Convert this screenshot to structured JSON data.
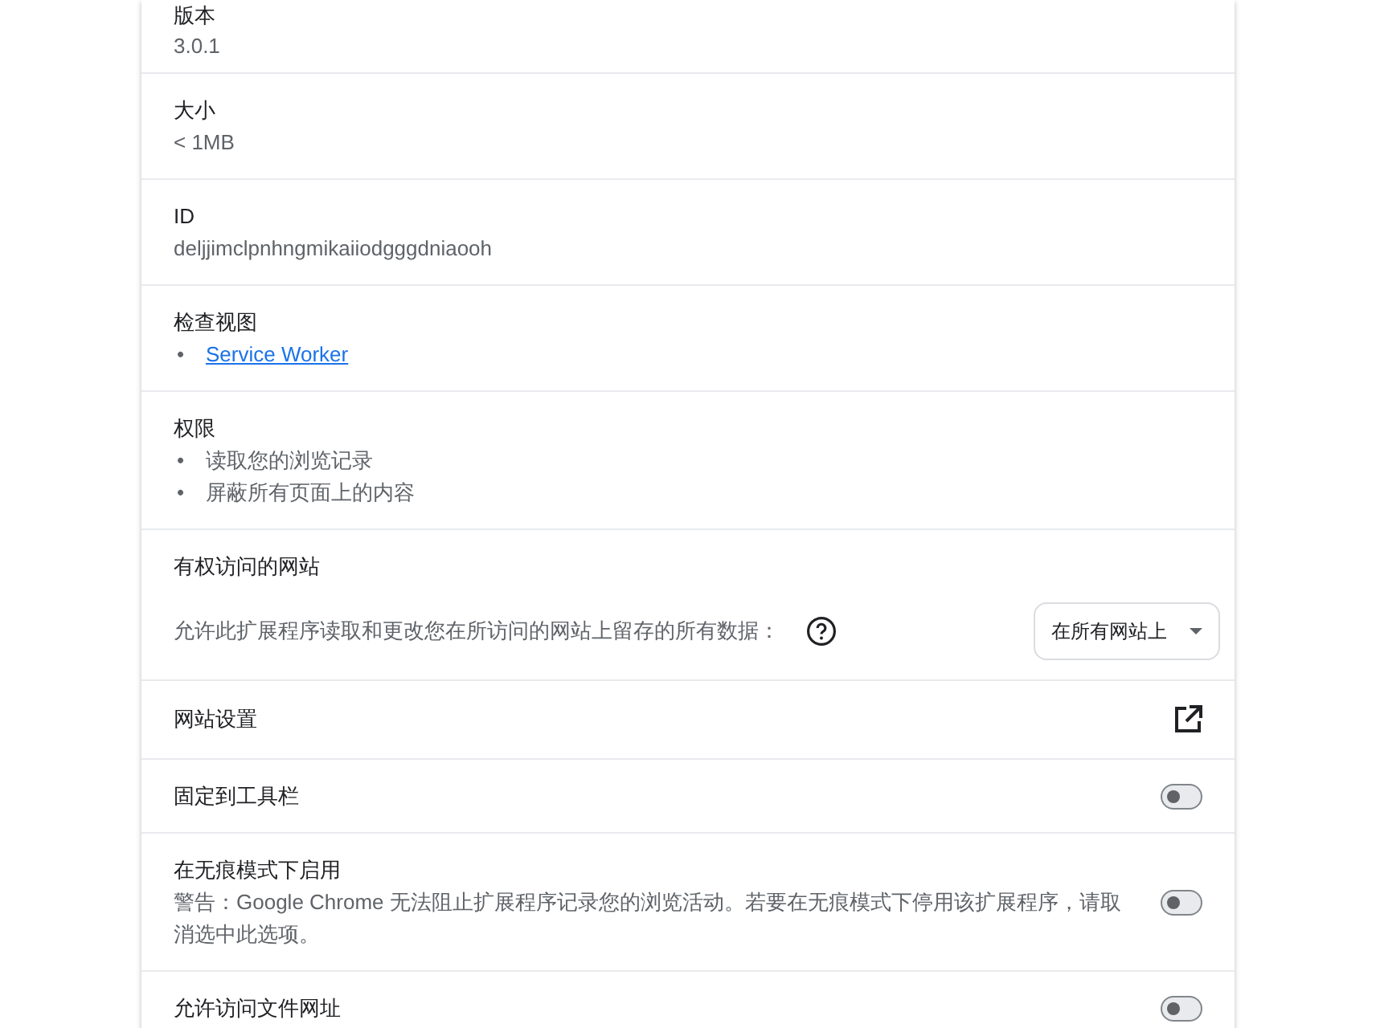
{
  "sections": [
    {
      "kind": "info",
      "label": "版本",
      "value": "3.0.1"
    },
    {
      "kind": "info",
      "label": "大小",
      "value": "< 1MB"
    },
    {
      "kind": "info",
      "label": "ID",
      "value": "deljjimclpnhngmikaiiodgggdniaooh"
    },
    {
      "kind": "links",
      "label": "检查视图",
      "items": [
        {
          "bullet": "•",
          "text": "Service Worker"
        }
      ]
    },
    {
      "kind": "list",
      "label": "权限",
      "items": [
        {
          "bullet": "•",
          "text": "读取您的浏览记录"
        },
        {
          "bullet": "•",
          "text": "屏蔽所有页面上的内容"
        }
      ]
    },
    {
      "kind": "access",
      "label": "有权访问的网站",
      "description": "允许此扩展程序读取和更改您在所访问的网站上留存的所有数据：",
      "select": "在所有网站上"
    },
    {
      "kind": "external",
      "label": "网站设置"
    },
    {
      "kind": "toggle",
      "label": "固定到工具栏",
      "on": false
    },
    {
      "kind": "toggle",
      "label": "在无痕模式下启用",
      "description": "警告：Google Chrome 无法阻止扩展程序记录您的浏览活动。若要在无痕模式下停用该扩展程序，请取消选中此选项。",
      "on": false
    },
    {
      "kind": "toggle",
      "label": "允许访问文件网址",
      "on": false
    }
  ]
}
